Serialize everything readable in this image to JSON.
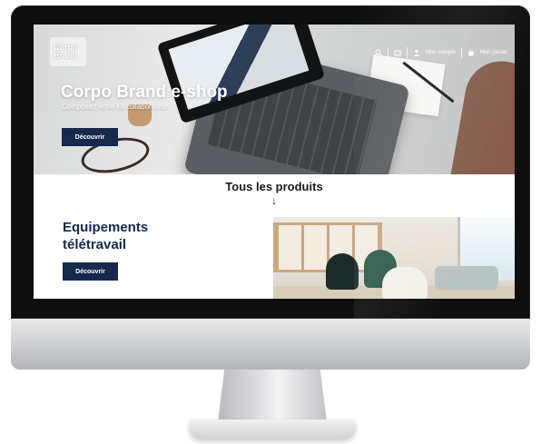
{
  "site": {
    "logo_line1": "Corpo",
    "logo_line2": "Brand"
  },
  "nav": {
    "account_label": "Mon compte",
    "cart_label": "Mon panier"
  },
  "hero": {
    "title": "Corpo Brand e-shop",
    "subtitle": "Composez votre kit collaborateur",
    "button_label": "Découvrir"
  },
  "products": {
    "section_title": "Tous les produits",
    "arrow": "↓"
  },
  "equipment": {
    "title_line1": "Equipements",
    "title_line2": "télétravail",
    "button_label": "Découvrir"
  },
  "colors": {
    "accent_navy": "#14294b",
    "bezel": "#0e0e0e"
  },
  "icons": [
    "search-icon",
    "cart-icon",
    "user-icon",
    "bag-icon"
  ]
}
